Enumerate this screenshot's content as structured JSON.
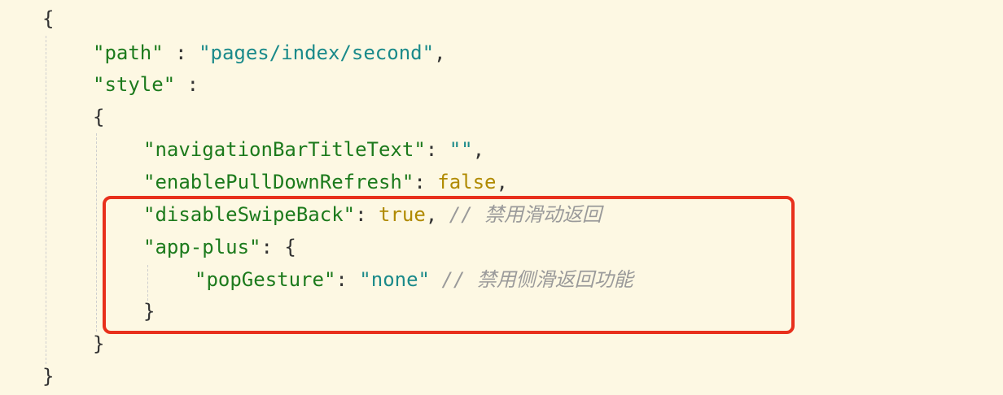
{
  "editor": {
    "lines": [
      {
        "tokens": [
          {
            "t": "{",
            "c": "p"
          }
        ]
      },
      {
        "tokens": [
          {
            "t": "\"path\"",
            "c": "k"
          },
          {
            "t": " : ",
            "c": "p"
          },
          {
            "t": "\"pages/index/second\"",
            "c": "s"
          },
          {
            "t": ",",
            "c": "p"
          }
        ]
      },
      {
        "tokens": [
          {
            "t": "\"style\"",
            "c": "k"
          },
          {
            "t": " :",
            "c": "p"
          }
        ]
      },
      {
        "tokens": [
          {
            "t": "{",
            "c": "p"
          }
        ]
      },
      {
        "tokens": [
          {
            "t": "\"navigationBarTitleText\"",
            "c": "k"
          },
          {
            "t": ": ",
            "c": "p"
          },
          {
            "t": "\"\"",
            "c": "s"
          },
          {
            "t": ",",
            "c": "p"
          }
        ]
      },
      {
        "tokens": [
          {
            "t": "\"enablePullDownRefresh\"",
            "c": "k"
          },
          {
            "t": ": ",
            "c": "p"
          },
          {
            "t": "false",
            "c": "lit"
          },
          {
            "t": ",",
            "c": "p"
          }
        ]
      },
      {
        "tokens": [
          {
            "t": "\"disableSwipeBack\"",
            "c": "k"
          },
          {
            "t": ": ",
            "c": "p"
          },
          {
            "t": "true",
            "c": "lit"
          },
          {
            "t": ", ",
            "c": "p"
          },
          {
            "t": "// ",
            "c": "c"
          },
          {
            "t": "禁用滑动返回",
            "c": "c cjk"
          }
        ]
      },
      {
        "tokens": [
          {
            "t": "\"app-plus\"",
            "c": "k"
          },
          {
            "t": ": {",
            "c": "p"
          }
        ]
      },
      {
        "tokens": [
          {
            "t": "\"popGesture\"",
            "c": "k"
          },
          {
            "t": ": ",
            "c": "p"
          },
          {
            "t": "\"none\"",
            "c": "s"
          },
          {
            "t": " ",
            "c": "p"
          },
          {
            "t": "// ",
            "c": "c"
          },
          {
            "t": "禁用侧滑返回功能",
            "c": "c cjk"
          }
        ]
      },
      {
        "tokens": [
          {
            "t": "}",
            "c": "p"
          }
        ]
      },
      {
        "tokens": [
          {
            "t": "}",
            "c": "p"
          }
        ]
      },
      {
        "tokens": [
          {
            "t": "}",
            "c": "p"
          }
        ]
      }
    ]
  },
  "colors": {
    "background": "#fdf8e3",
    "key": "#1c7a1c",
    "string": "#1a8a8a",
    "literal": "#b08a00",
    "comment": "#9a9a9a",
    "highlight_border": "#e8301c"
  }
}
